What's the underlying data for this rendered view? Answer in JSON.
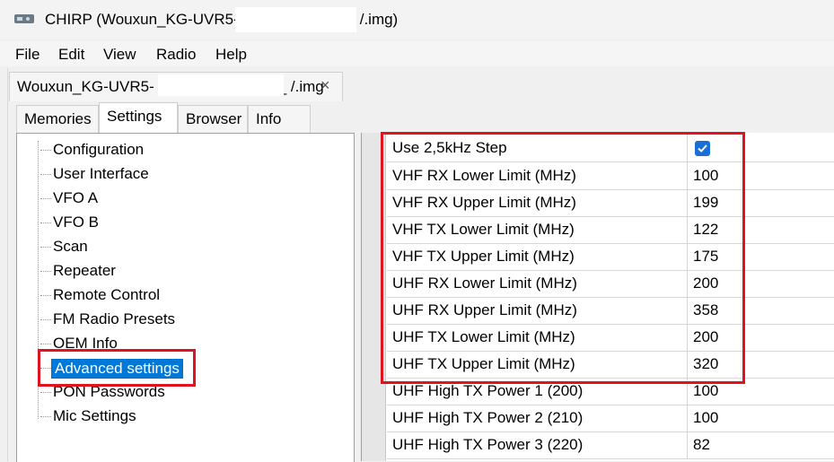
{
  "window": {
    "title_prefix": "CHIRP (Wouxun_KG-UVR5-",
    "title_suffix": "/.img)"
  },
  "menu": [
    "File",
    "Edit",
    "View",
    "Radio",
    "Help"
  ],
  "document_tab": {
    "label": "Wouxun_KG-UVR5-",
    "label_suffix": "_ /.img",
    "close": "×"
  },
  "tabs": [
    "Memories",
    "Settings",
    "Browser",
    "Info"
  ],
  "active_tab": "Settings",
  "tree": {
    "items": [
      "Configuration",
      "User Interface",
      "VFO A",
      "VFO B",
      "Scan",
      "Repeater",
      "Remote Control",
      "FM Radio Presets",
      "OEM Info",
      "Advanced settings",
      "PON Passwords",
      "Mic Settings"
    ],
    "selected": "Advanced settings"
  },
  "settings_grid": {
    "rows": [
      {
        "name": "Use 2,5kHz Step",
        "value": "",
        "checkbox": true
      },
      {
        "name": "VHF RX Lower Limit (MHz)",
        "value": "100"
      },
      {
        "name": "VHF RX Upper Limit (MHz)",
        "value": "199"
      },
      {
        "name": "VHF TX Lower Limit (MHz)",
        "value": "122"
      },
      {
        "name": "VHF TX Upper Limit (MHz)",
        "value": "175"
      },
      {
        "name": "UHF RX Lower Limit (MHz)",
        "value": "200"
      },
      {
        "name": "UHF RX Upper Limit (MHz)",
        "value": "358"
      },
      {
        "name": "UHF TX Lower Limit (MHz)",
        "value": "200"
      },
      {
        "name": "UHF TX Upper Limit (MHz)",
        "value": "320"
      },
      {
        "name": "UHF High TX Power 1 (200)",
        "value": "100"
      },
      {
        "name": "UHF High TX Power 2 (210)",
        "value": "100"
      },
      {
        "name": "UHF High TX Power 3 (220)",
        "value": "82"
      }
    ]
  },
  "colors": {
    "highlight_box": "#e0141e",
    "selection": "#0078d7",
    "checkbox": "#1a6fd6"
  }
}
